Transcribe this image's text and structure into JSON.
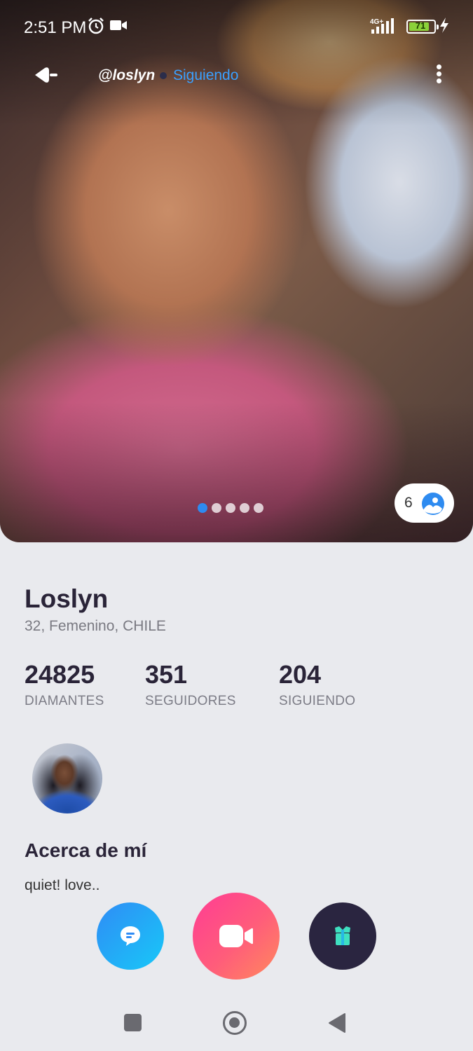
{
  "status_bar": {
    "time": "2:51 PM",
    "network": "4G+",
    "battery": "71",
    "icons": [
      "alarm-icon",
      "video-icon",
      "signal-icon",
      "battery-icon",
      "charging-bolt-icon"
    ]
  },
  "header": {
    "handle": "@loslyn",
    "follow_status": "Siguiendo",
    "back_icon": "back-arrow-icon",
    "menu_icon": "more-vertical-icon"
  },
  "gallery": {
    "pages": 5,
    "active_page": 1,
    "photo_count": "6",
    "photo_icon": "photo-icon"
  },
  "profile": {
    "name": "Loslyn",
    "details": "32, Femenino, CHILE",
    "stats": [
      {
        "value": "24825",
        "label": "DIAMANTES"
      },
      {
        "value": "351",
        "label": "SEGUIDORES"
      },
      {
        "value": "204",
        "label": "SIGUIENDO"
      }
    ],
    "about_title": "Acerca de mí",
    "about_text": "quiet! love.."
  },
  "actions": {
    "chat_icon": "chat-bubble-icon",
    "video_icon": "video-camera-icon",
    "gift_icon": "gift-icon"
  },
  "colors": {
    "accent_blue": "#2e8bf0",
    "follow_blue": "#3aa0ff",
    "video_pink": "#ff3c94",
    "gift_dark": "#2a2540",
    "background": "#e9eaee"
  }
}
